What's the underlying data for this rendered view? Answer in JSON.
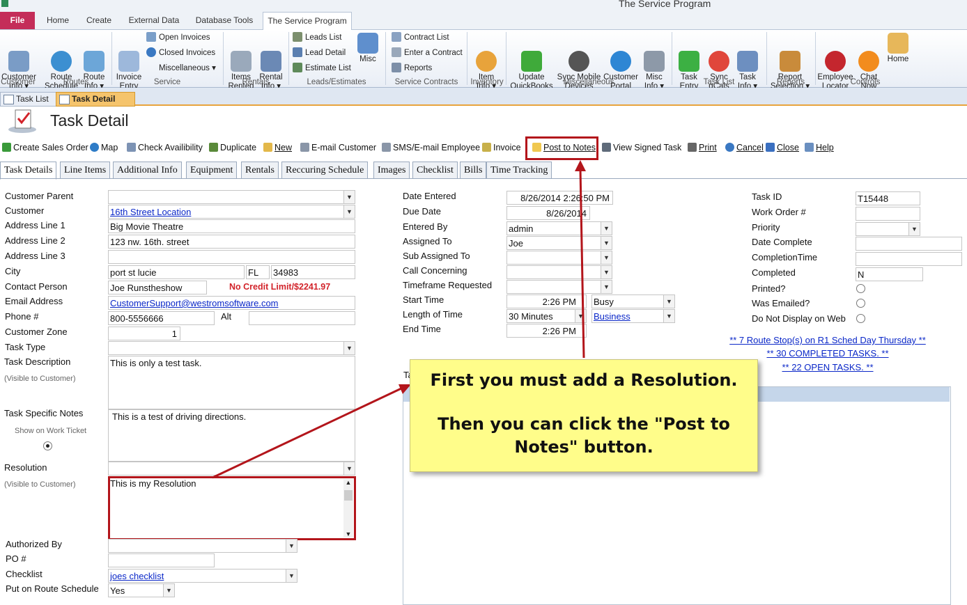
{
  "app_title": "The Service Program",
  "ribbon_tabs": [
    "File",
    "Home",
    "Create",
    "External Data",
    "Database Tools",
    "The Service Program"
  ],
  "ribbon": {
    "customer_info": "Customer\nInfo ▾",
    "route_schedule": "Route\nSchedule",
    "route_info": "Route\nInfo ▾",
    "invoice_entry": "Invoice\nEntry",
    "open_invoices": "Open Invoices",
    "closed_invoices": "Closed Invoices",
    "miscellaneous_menu": "Miscellaneous ▾",
    "items_rented": "Items\nRented",
    "rental_info": "Rental\nInfo ▾",
    "leads_list": "Leads List",
    "lead_detail": "Lead Detail",
    "estimate_list": "Estimate List",
    "misc": "Misc",
    "contract_list": "Contract List",
    "enter_contract": "Enter a Contract",
    "reports": "Reports",
    "item_info": "Item\nInfo ▾",
    "update_quickbooks": "Update\nQuickBooks",
    "sync_mobile": "Sync Mobile\nDevices",
    "customer_portal": "Customer\nPortal",
    "misc_info": "Misc\nInfo ▾",
    "task_entry": "Task\nEntry",
    "sync_gcals": "Sync\ngCals",
    "task_info": "Task\nInfo ▾",
    "report_selection": "Report\nSelection ▾",
    "employee_locator": "Employee\nLocator",
    "chat_now": "Chat\nNow",
    "home": "Home",
    "groups": [
      "Customer",
      "Routes",
      "Service",
      "Rentals",
      "Leads/Estimates",
      "Service Contracts",
      "Inventory",
      "Miscellaneous",
      "Task List",
      "Reports",
      "Controls"
    ]
  },
  "doc_tabs": [
    "Task List",
    "Task Detail"
  ],
  "form_title": "Task Detail",
  "toolbar": [
    "Create Sales Order",
    "Map",
    "Check Availibility",
    "Duplicate",
    "New",
    "E-mail Customer",
    "SMS/E-mail Employee",
    "Invoice",
    "Post to Notes",
    "View Signed Task",
    "Print",
    "Cancel",
    "Close",
    "Help"
  ],
  "form_tabs": [
    "Task Details",
    "Line Items",
    "Additional Info",
    "Equipment",
    "Rentals",
    "Reccuring Schedule",
    "Images",
    "Checklist",
    "Bills",
    "Time Tracking"
  ],
  "left": {
    "labels": {
      "customer_parent": "Customer Parent",
      "customer": "Customer",
      "address1": "Address Line 1",
      "address2": "Address Line 2",
      "address3": "Address Line 3",
      "city": "City",
      "contact": "Contact Person",
      "email": "Email Address",
      "phone": "Phone #",
      "alt": "Alt",
      "zone": "Customer Zone",
      "task_type": "Task Type",
      "task_desc": "Task Description",
      "visible1": "(Visible to Customer)",
      "task_notes": "Task Specific Notes",
      "show_ticket": "Show on Work Ticket",
      "resolution": "Resolution",
      "visible2": "(Visible to Customer)",
      "authorized": "Authorized By",
      "po": "PO #",
      "checklist": "Checklist",
      "route_sched": "Put on Route Schedule"
    },
    "values": {
      "customer": "16th Street Location",
      "address1": "Big Movie Theatre",
      "address2": "123 nw. 16th. street",
      "city": "port st lucie",
      "state": "FL",
      "zip": "34983",
      "contact": "Joe Runstheshow",
      "credit": "No Credit Limit/$2241.97",
      "email": "CustomerSupport@westromsoftware.com",
      "phone": "800-5556666",
      "zone": "1",
      "task_desc": "This is only a test task.",
      "task_notes": "This is a test of driving directions.",
      "resolution_text": "This is my Resolution",
      "checklist": "joes checklist",
      "route_sched": "Yes"
    }
  },
  "mid": {
    "labels": {
      "date_entered": "Date Entered",
      "due_date": "Due Date",
      "entered_by": "Entered By",
      "assigned_to": "Assigned To",
      "sub_assigned": "Sub Assigned To",
      "call_concerning": "Call Concerning",
      "timeframe": "Timeframe Requested",
      "start_time": "Start Time",
      "length": "Length of Time",
      "end_time": "End Time",
      "ta": "Ta"
    },
    "values": {
      "date_entered": "8/26/2014 2:26:50 PM",
      "due_date": "8/26/2014",
      "entered_by": "admin",
      "assigned_to": "Joe",
      "start_time": "2:26 PM",
      "status": "Busy",
      "length": "30 Minutes",
      "category": "Business",
      "end_time": "2:26 PM"
    }
  },
  "right": {
    "labels": {
      "task_id": "Task ID",
      "work_order": "Work Order #",
      "priority": "Priority",
      "date_complete": "Date Complete",
      "completion_time": "CompletionTime",
      "completed": "Completed",
      "printed": "Printed?",
      "emailed": "Was Emailed?",
      "no_display": "Do Not Display on Web"
    },
    "values": {
      "task_id": "T15448",
      "completed": "N"
    },
    "links": [
      "** 7 Route Stop(s) on R1 Sched Day Thursday **",
      "** 30 COMPLETED TASKS. **",
      "** 22 OPEN TASKS. **"
    ]
  },
  "callout": {
    "line1": "First you must add a Resolution.",
    "line2": "Then you can click the \"Post to",
    "line3": "Notes\" button."
  },
  "colors": {
    "file_tab": "#c42d59",
    "highlight": "#b3151b",
    "callout": "#fffd8a",
    "active_doc_tab": "#f5c46c",
    "link": "#0a27c8"
  }
}
